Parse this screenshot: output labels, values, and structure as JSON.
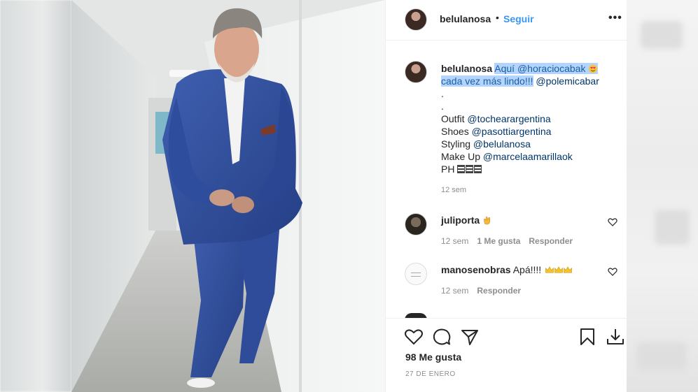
{
  "post": {
    "author": "belulanosa",
    "dot": "•",
    "follow_label": "Seguir",
    "more_label": "•••",
    "caption": {
      "user": "belulanosa",
      "highlight_line1": "Aquí @horaciocabak",
      "highlight_line2": "cada vez más lindo!!!",
      "mention_after": "@polemicabar",
      "dot1": ".",
      "dot2": ".",
      "outfit_label": "Outfit",
      "outfit_mention": "@tochearargentina",
      "shoes_label": "Shoes",
      "shoes_mention": "@pasottiargentina",
      "styling_label": "Styling",
      "styling_mention": "@belulanosa",
      "makeup_label": "Make Up",
      "makeup_mention": "@marcelaamarillaok",
      "ph_label": "PH",
      "time": "12 sem"
    },
    "comments": [
      {
        "user": "juliporta",
        "text": "",
        "emoji": "clap-icon",
        "time": "12 sem",
        "likes": "1 Me gusta",
        "reply": "Responder"
      },
      {
        "user": "manosenobras",
        "text": "Apá!!!!",
        "emoji": "crown-icon",
        "time": "12 sem",
        "reply": "Responder"
      }
    ],
    "likes_label": "98 Me gusta",
    "date_label": "27 DE ENERO",
    "icons": [
      "heart-icon",
      "comment-icon",
      "share-icon",
      "bookmark-icon",
      "download-icon"
    ]
  }
}
